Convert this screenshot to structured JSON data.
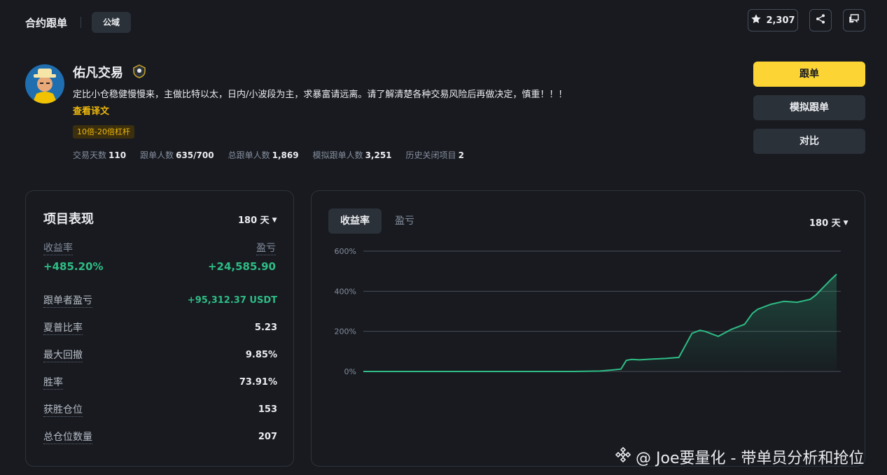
{
  "header": {
    "title": "合约跟单",
    "chip": "公域",
    "favorites_count": "2,307"
  },
  "profile": {
    "name": "佑凡交易",
    "description": "定比小仓稳健慢慢来，主做比特以太，日内/小波段为主，求暴富请远离。请了解清楚各种交易风险后再做决定，慎重！！！",
    "translate_link": "查看译文",
    "leverage_tag": "10倍-20倍杠杆",
    "stats": [
      {
        "label": "交易天数",
        "value": "110"
      },
      {
        "label": "跟单人数",
        "value": "635/700"
      },
      {
        "label": "总跟单人数",
        "value": "1,869"
      },
      {
        "label": "模拟跟单人数",
        "value": "3,251"
      },
      {
        "label": "历史关闭项目",
        "value": "2"
      }
    ]
  },
  "actions": {
    "follow": "跟单",
    "mock_follow": "模拟跟单",
    "compare": "对比"
  },
  "performance": {
    "title": "项目表现",
    "period": "180 天",
    "roi_label": "收益率",
    "roi_value": "+485.20%",
    "pnl_label": "盈亏",
    "pnl_value": "+24,585.90",
    "rows": [
      {
        "label": "跟单者盈亏",
        "value": "+95,312.37 USDT",
        "green": true
      },
      {
        "label": "夏普比率",
        "value": "5.23"
      },
      {
        "label": "最大回撤",
        "value": "9.85%"
      },
      {
        "label": "胜率",
        "value": "73.91%"
      },
      {
        "label": "获胜仓位",
        "value": "153"
      },
      {
        "label": "总仓位数量",
        "value": "207"
      }
    ]
  },
  "chart_panel": {
    "tabs": [
      "收益率",
      "盈亏"
    ],
    "period": "180 天"
  },
  "chart_data": {
    "type": "area",
    "ylim": [
      0,
      600
    ],
    "yticks": [
      "600%",
      "400%",
      "200%",
      "0%"
    ],
    "series": [
      {
        "color": "#2ebd85",
        "x": [
          0,
          10,
          20,
          30,
          40,
          50,
          60,
          70,
          80,
          90,
          95,
          98,
          100,
          102,
          105,
          110,
          115,
          120,
          125,
          128,
          130,
          135,
          140,
          145,
          148,
          150,
          155,
          160,
          165,
          170,
          172,
          175,
          178,
          180
        ],
        "values": [
          0,
          0,
          0,
          0,
          0,
          0,
          0,
          0,
          0,
          2,
          8,
          12,
          55,
          60,
          58,
          62,
          65,
          70,
          190,
          205,
          200,
          175,
          210,
          235,
          290,
          310,
          335,
          350,
          345,
          360,
          380,
          420,
          460,
          485
        ]
      }
    ],
    "grid": true
  },
  "watermark": "@ Joe要量化 - 带单员分析和抢位",
  "colors": {
    "accent_yellow": "#fcd535",
    "positive_green": "#2ebd85",
    "background": "#181a20",
    "panel": "#2b3139"
  }
}
